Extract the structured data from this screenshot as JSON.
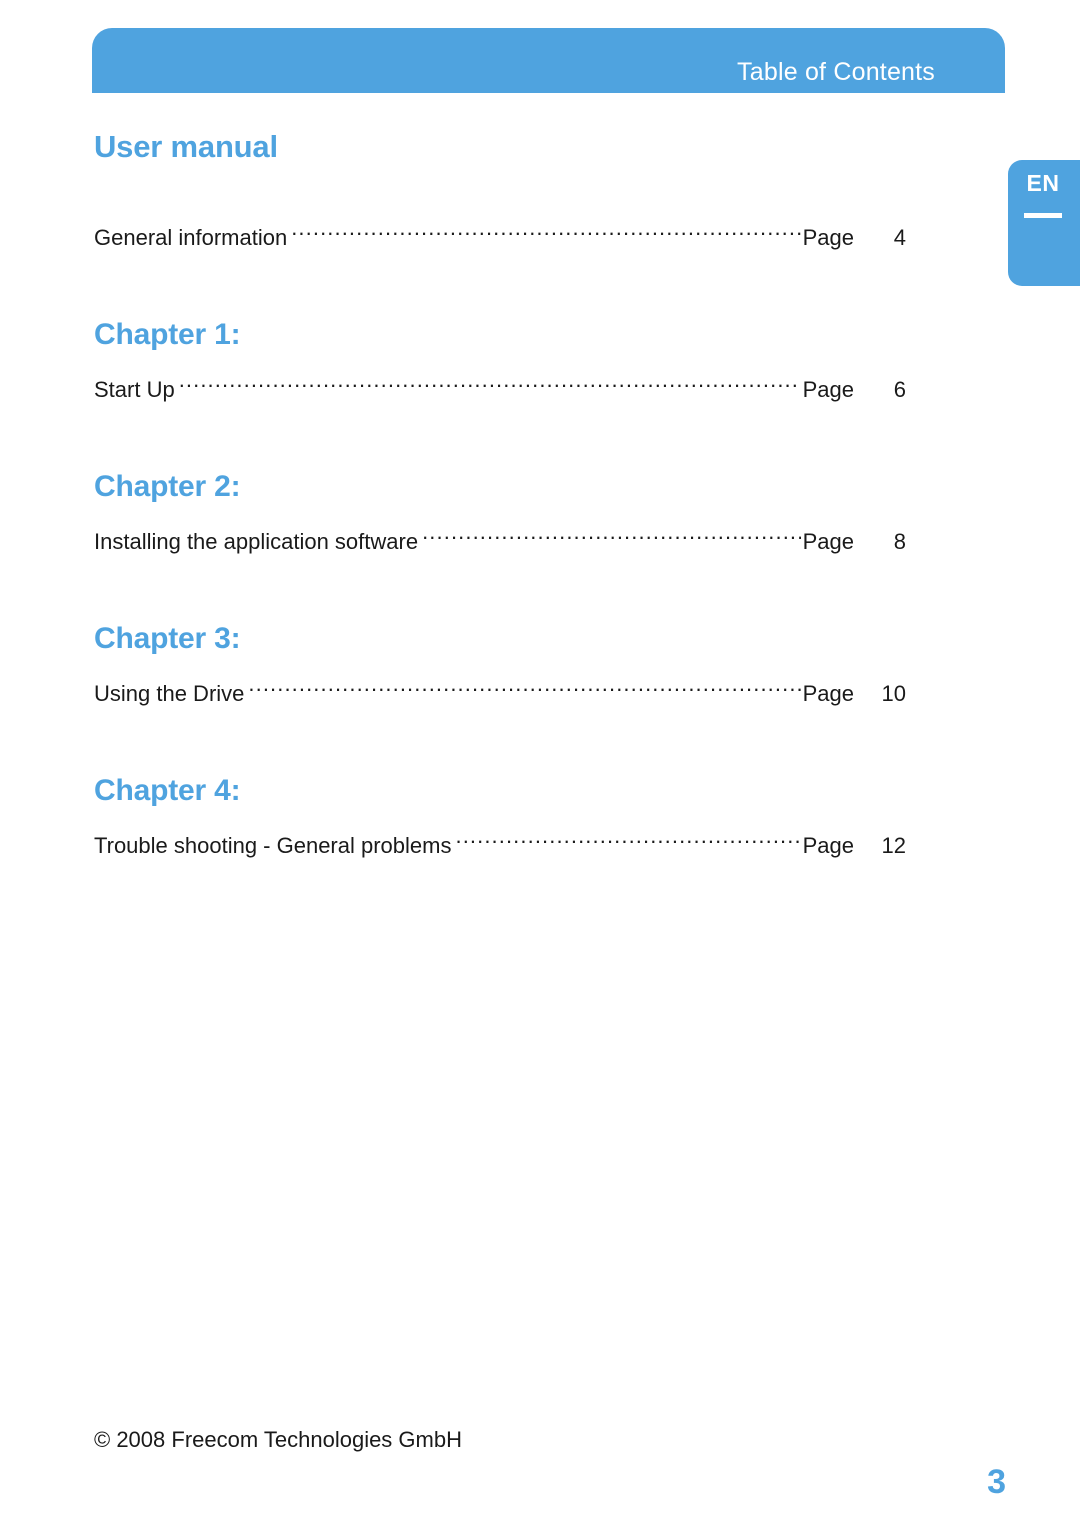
{
  "header": {
    "title": "Table of Contents"
  },
  "language_tab": {
    "label": "EN"
  },
  "document": {
    "title": "User manual"
  },
  "toc": {
    "page_word": "Page",
    "entries": [
      {
        "heading": null,
        "label": "General information",
        "page_word": "Page",
        "page": "4"
      },
      {
        "heading": "Chapter 1:",
        "label": "Start Up",
        "page_word": "Page",
        "page": "6"
      },
      {
        "heading": "Chapter 2:",
        "label": "Installing the application software",
        "page_word": "Page",
        "page": "8"
      },
      {
        "heading": "Chapter 3:",
        "label": "Using the Drive",
        "page_word": "Page",
        "page": "10"
      },
      {
        "heading": "Chapter 4:",
        "label": "Trouble shooting - General problems",
        "page_word": "Page",
        "page": "12"
      }
    ]
  },
  "footer": {
    "copyright": "© 2008 Freecom Technologies GmbH",
    "page_number": "3"
  },
  "colors": {
    "accent": "#4FA3DF",
    "text": "#1a1a1a",
    "header_text": "#ffffff"
  }
}
